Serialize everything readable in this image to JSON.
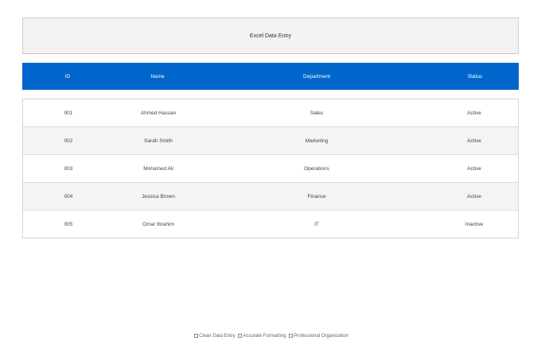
{
  "title": "Excel Data Entry",
  "columns": {
    "id": "ID",
    "name": "Name",
    "department": "Department",
    "status": "Status"
  },
  "rows": [
    {
      "id": "001",
      "name": "Ahmed Hassan",
      "department": "Sales",
      "status": "Active"
    },
    {
      "id": "002",
      "name": "Sarah Smith",
      "department": "Marketing",
      "status": "Active"
    },
    {
      "id": "003",
      "name": "Mohamed Ali",
      "department": "Operations",
      "status": "Active"
    },
    {
      "id": "004",
      "name": "Jessica Brown",
      "department": "Finance",
      "status": "Active"
    },
    {
      "id": "005",
      "name": "Omar Ibrahim",
      "department": "IT",
      "status": "Inactive"
    }
  ],
  "footer": {
    "items": [
      "Clean Data Entry",
      "Accurate Formatting",
      "Professional Organization"
    ]
  },
  "colors": {
    "header_bg": "#0066cc",
    "alt_row_bg": "#f4f4f4"
  }
}
